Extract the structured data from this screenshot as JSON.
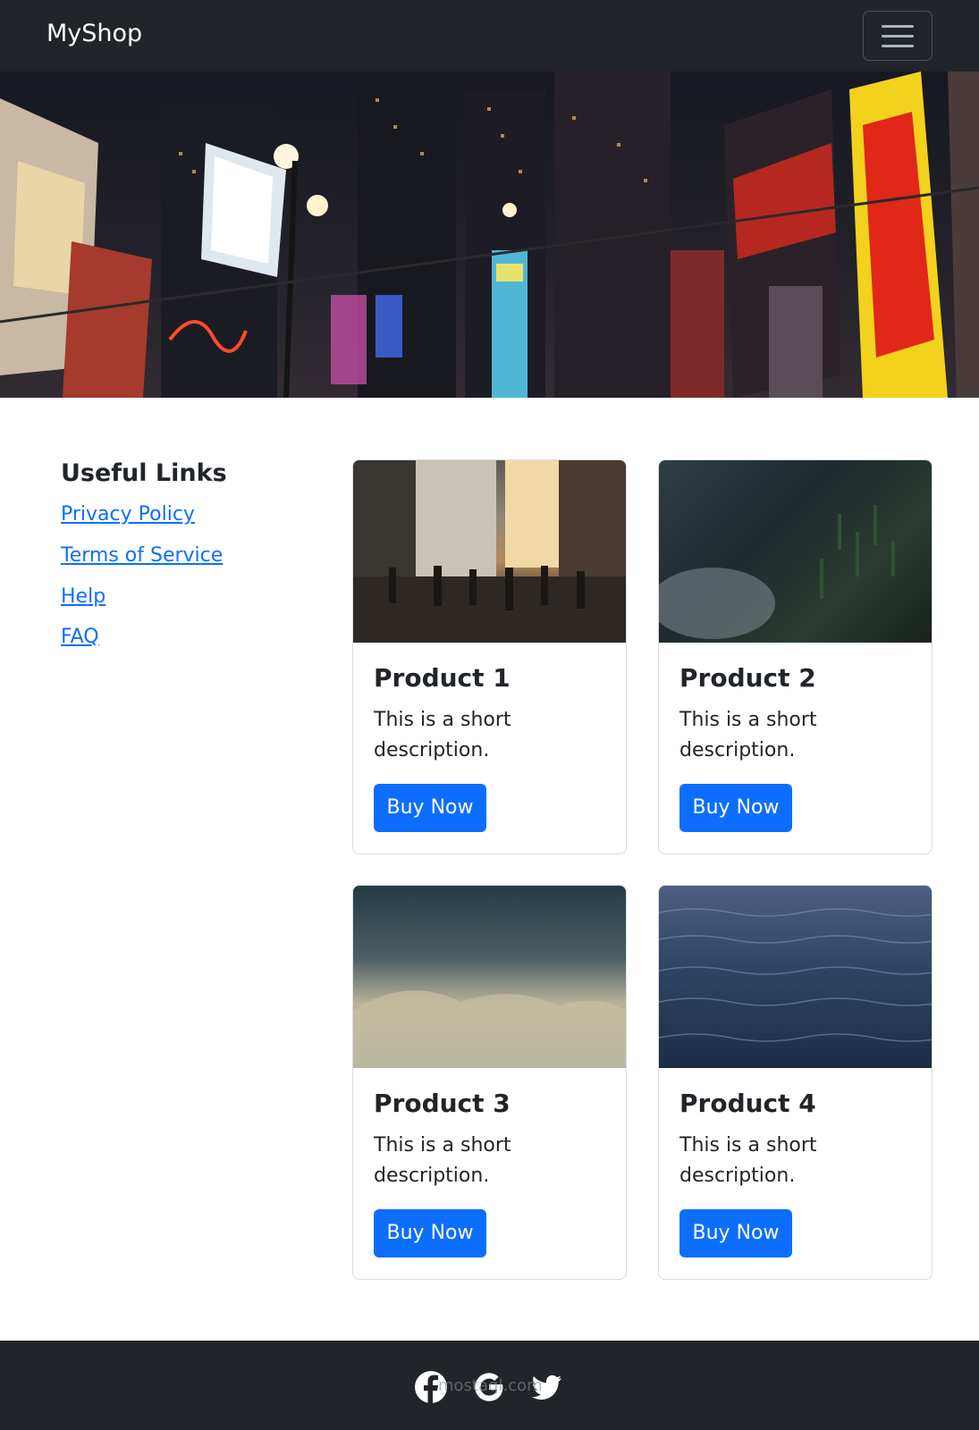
{
  "navbar": {
    "brand": "MyShop",
    "menu_icon": "hamburger-menu-icon"
  },
  "hero": {
    "description_icon": "city-night-banner-image"
  },
  "sidebar": {
    "title": "Useful Links",
    "links": [
      {
        "label": "Privacy Policy"
      },
      {
        "label": "Terms of Service"
      },
      {
        "label": "Help"
      },
      {
        "label": "FAQ"
      }
    ]
  },
  "products": [
    {
      "title": "Product 1",
      "description": "This is a short description.",
      "button": "Buy Now",
      "image_icon": "city-street-image"
    },
    {
      "title": "Product 2",
      "description": "This is a short description.",
      "button": "Buy Now",
      "image_icon": "forest-landscape-image"
    },
    {
      "title": "Product 3",
      "description": "This is a short description.",
      "button": "Buy Now",
      "image_icon": "cloudy-sky-image"
    },
    {
      "title": "Product 4",
      "description": "This is a short description.",
      "button": "Buy Now",
      "image_icon": "ocean-waves-image"
    }
  ],
  "footer": {
    "social_icons": [
      "facebook-icon",
      "google-icon",
      "twitter-icon"
    ],
    "watermark": "mostaql.com"
  },
  "colors": {
    "navbar_bg": "#212529",
    "primary": "#0d6efd",
    "link": "#0d6efd"
  }
}
